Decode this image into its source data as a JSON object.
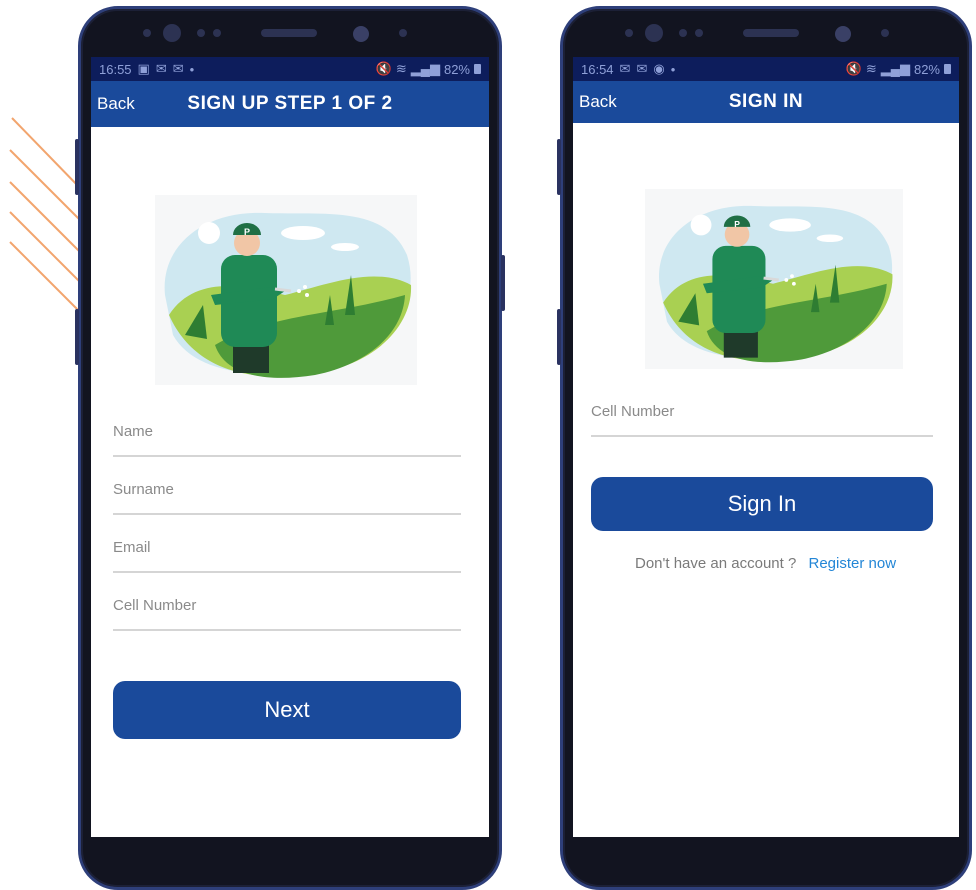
{
  "decoration": {
    "line_color": "#f2a56e"
  },
  "left_phone": {
    "status_bar": {
      "time": "16:55",
      "notification_icons": [
        "image-icon",
        "mail-icon",
        "mail-icon"
      ],
      "battery": "82%"
    },
    "header": {
      "back_label": "Back",
      "title": "SIGN UP STEP 1 OF 2",
      "background": "#1a4a9b"
    },
    "fields": [
      {
        "placeholder": "Name"
      },
      {
        "placeholder": "Surname"
      },
      {
        "placeholder": "Email"
      },
      {
        "placeholder": "Cell Number"
      }
    ],
    "next_button": {
      "label": "Next"
    }
  },
  "right_phone": {
    "status_bar": {
      "time": "16:54",
      "notification_icons": [
        "mail-icon",
        "mail-icon",
        "messenger-icon"
      ],
      "battery": "82%"
    },
    "header": {
      "back_label": "Back",
      "title": "SIGN IN",
      "background": "#1a4a9b"
    },
    "fields": [
      {
        "placeholder": "Cell Number"
      }
    ],
    "sign_in_button": {
      "label": "Sign In"
    },
    "register": {
      "prompt": "Don't have an account ?",
      "link": "Register now",
      "link_color": "#2386d6"
    }
  },
  "illustration": {
    "badge_letter": "P"
  }
}
